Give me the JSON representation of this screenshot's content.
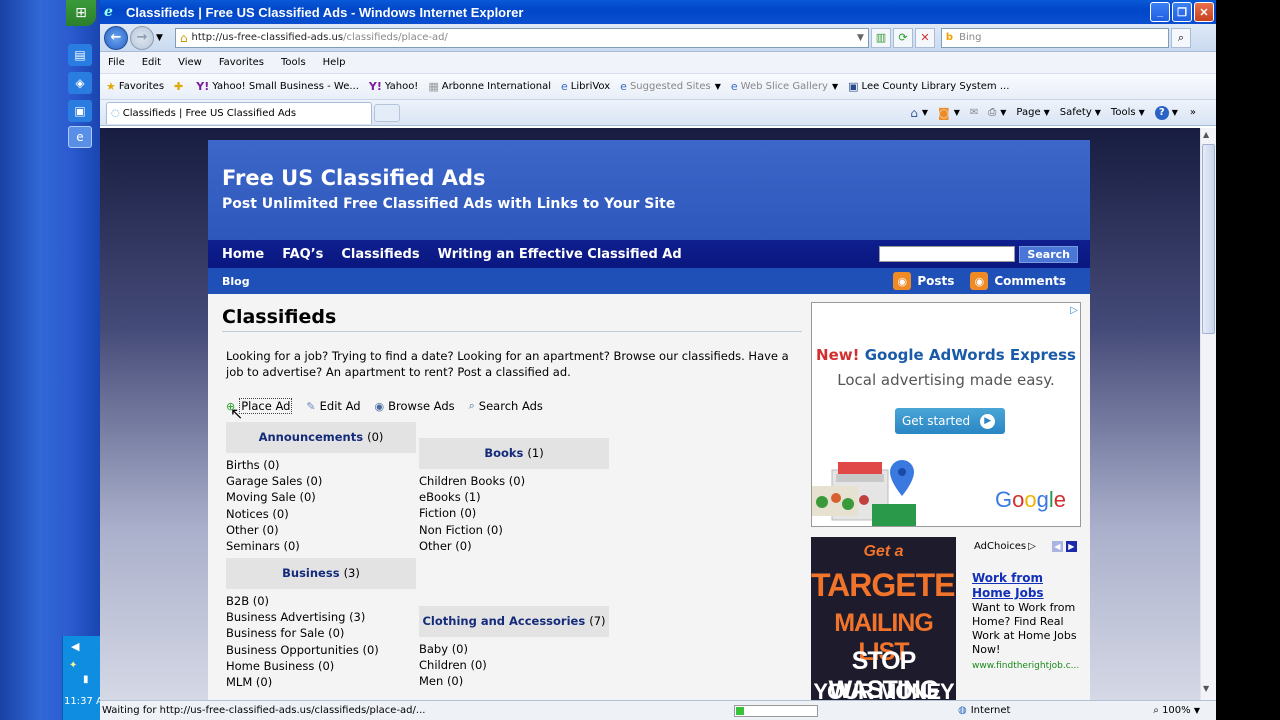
{
  "taskbar": {
    "clock": "11:37 A"
  },
  "window": {
    "title": "Classifieds | Free US Classified Ads - Windows Internet Explorer"
  },
  "address": {
    "url_host": "http://us-free-classified-ads.us",
    "url_path": "/classifieds/place-ad/",
    "search_placeholder": "Bing"
  },
  "menu": [
    "File",
    "Edit",
    "View",
    "Favorites",
    "Tools",
    "Help"
  ],
  "favorites": {
    "label": "Favorites",
    "items": [
      "Yahoo! Small Business - We...",
      "Yahoo!",
      "Arbonne International",
      "LibriVox",
      "Suggested Sites",
      "Web Slice Gallery",
      "Lee County Library System ..."
    ]
  },
  "tab": {
    "title": "Classifieds | Free US Classified Ads"
  },
  "commands": {
    "page": "Page",
    "safety": "Safety",
    "tools": "Tools"
  },
  "status": {
    "text": "Waiting for http://us-free-classified-ads.us/classifieds/place-ad/...",
    "zone": "Internet",
    "zoom": "100%",
    "progress": 0.1
  },
  "site": {
    "title": "Free US Classified Ads",
    "tagline": "Post Unlimited Free Classified Ads with Links to Your Site",
    "nav": [
      "Home",
      "FAQ’s",
      "Classifieds",
      "Writing an Effective Classified Ad"
    ],
    "search_button": "Search",
    "subnav": "Blog",
    "feeds": {
      "posts": "Posts",
      "comments": "Comments"
    }
  },
  "main": {
    "title": "Classifieds",
    "intro": "Looking for a job? Trying to find a date? Looking for an apartment? Browse our classifieds. Have a job to advertise? An apartment to rent? Post a classified ad.",
    "actions": [
      "Place Ad",
      "Edit Ad",
      "Browse Ads",
      "Search Ads"
    ]
  },
  "categories": {
    "announcements": {
      "name": "Announcements",
      "count": "(0)",
      "items": [
        "Births (0)",
        "Garage Sales (0)",
        "Moving Sale (0)",
        "Notices (0)",
        "Other (0)",
        "Seminars (0)"
      ]
    },
    "books": {
      "name": "Books",
      "count": "(1)",
      "items": [
        "Children Books (0)",
        "eBooks (1)",
        "Fiction (0)",
        "Non Fiction (0)",
        "Other (0)"
      ]
    },
    "business": {
      "name": "Business",
      "count": "(3)",
      "items": [
        "B2B (0)",
        "Business Advertising (3)",
        "Business for Sale (0)",
        "Business Opportunities (0)",
        "Home Business (0)",
        "MLM (0)"
      ]
    },
    "clothing": {
      "name": "Clothing and Accessories",
      "count": "(7)",
      "items": [
        "Baby (0)",
        "Children (0)",
        "Men (0)"
      ]
    }
  },
  "ad1": {
    "new": "New!",
    "headline": "Google AdWords Express",
    "sub": "Local advertising made easy.",
    "button": "Get started",
    "logo": "Google"
  },
  "ad2": {
    "img_lines": [
      "Get a",
      "TARGETED",
      "MAILING LIST",
      "STOP WASTING",
      "YOUR MONEY"
    ],
    "choices": "AdChoices",
    "link": "Work from Home Jobs",
    "body": "Want to Work from Home? Find Real Work at Home Jobs Now!",
    "url": "www.findtherightjob.c..."
  },
  "colors": {
    "nav_dark": "#0e1f8e",
    "header_blue": "#3d67c9",
    "link_blue": "#1230b8"
  }
}
